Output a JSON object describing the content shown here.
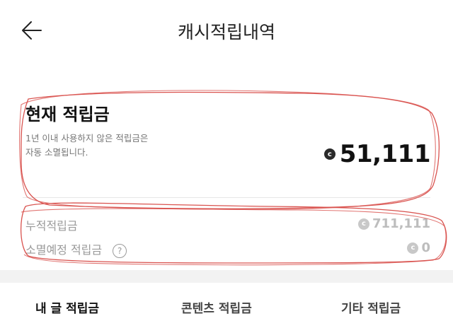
{
  "header": {
    "title": "캐시적립내역",
    "back_icon": "arrow-left-icon"
  },
  "current": {
    "title": "현재 적립금",
    "desc_line1": "1년 이내 사용하지 않은 적립금은",
    "desc_line2": "자동 소멸됩니다.",
    "coin_symbol": "c",
    "amount": "51,111"
  },
  "summary": {
    "accumulated_label": "누적적립금",
    "accumulated_value": "711,111",
    "expiring_label": "소멸예정 적립금",
    "expiring_value": "0",
    "help_symbol": "?"
  },
  "tabs": [
    {
      "label": "내 글 적립금",
      "active": true
    },
    {
      "label": "콘텐츠 적립금",
      "active": false
    },
    {
      "label": "기타 적립금",
      "active": false
    }
  ],
  "colors": {
    "annotation": "#d9534f",
    "primary_text": "#111111",
    "muted_text": "#9a9a9a",
    "band": "#f2f2f2"
  }
}
